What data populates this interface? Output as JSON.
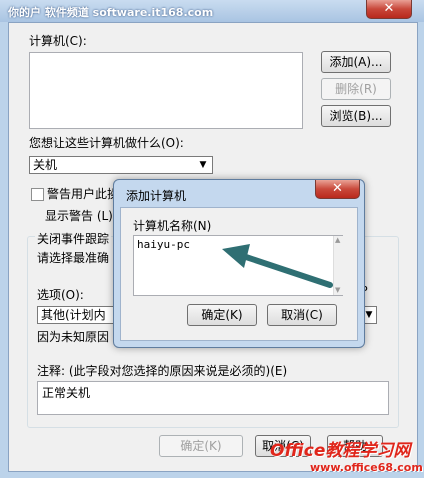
{
  "window": {
    "watermark": "你的户 软件频道 software.it168.com",
    "close_glyph": "✕"
  },
  "computers": {
    "label": "计算机(C):",
    "add_button": "添加(A)...",
    "remove_button": "删除(R)",
    "browse_button": "浏览(B)..."
  },
  "action": {
    "label": "您想让这些计算机做什么(O):",
    "selected": "关机"
  },
  "warn": {
    "checkbox_label": "警告用户此操",
    "display_label": "显示警告 (L)"
  },
  "tracker": {
    "group_label": "关闭事件跟踪",
    "instruction": "请选择最准确",
    "options_label": "选项(O):",
    "options_selected": "其他(计划内",
    "reason": "因为未知原因",
    "p_hint": "P"
  },
  "comment": {
    "label": "注释: (此字段对您选择的原因来说是必须的)(E)",
    "value": "正常关机"
  },
  "footer": {
    "ok_button": "确定(K)",
    "cancel_button": "取消(C)",
    "help_button": "帮助"
  },
  "dialog": {
    "title": "添加计算机",
    "name_label": "计算机名称(N)",
    "name_value": "haiyu-pc",
    "ok_button": "确定(K)",
    "cancel_button": "取消(C)"
  },
  "brand_watermark": {
    "main": "Office教程学习网",
    "url": "www.office68.com"
  },
  "colors": {
    "window_frame": "#bcd3ea",
    "close_red": "#c8473a",
    "arrow_teal": "#2f6f73",
    "watermark_red": "#e0261b"
  }
}
